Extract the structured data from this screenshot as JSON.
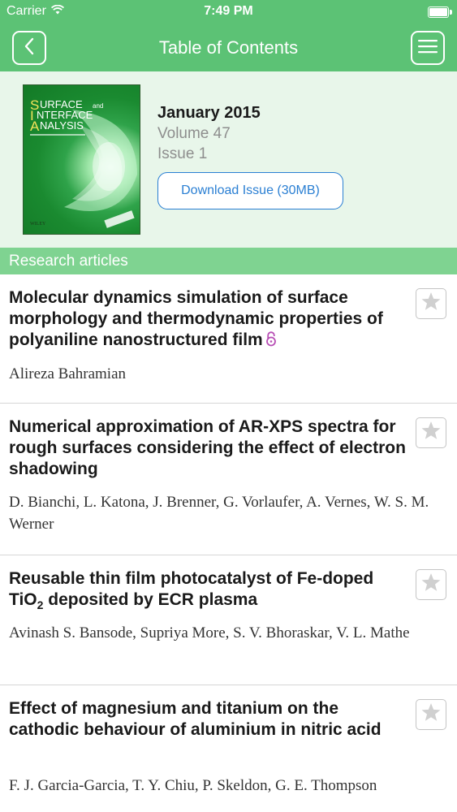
{
  "status_bar": {
    "carrier": "Carrier",
    "time": "7:49 PM"
  },
  "nav": {
    "title": "Table of Contents"
  },
  "issue": {
    "date": "January 2015",
    "volume": "Volume 47",
    "issue": "Issue 1",
    "download_label": "Download Issue (30MB)",
    "cover": {
      "line1": "URFACE",
      "line2": "NTERFACE",
      "line3": "NALYSIS",
      "initial1": "S",
      "initial2": "I",
      "initial3": "A",
      "and": "and",
      "publisher": "WILEY"
    }
  },
  "section": {
    "label": "Research articles"
  },
  "articles": [
    {
      "title": "Molecular dynamics simulation of surface morphology and thermodynamic properties of polyaniline nanostructured film",
      "authors": "Alireza Bahramian",
      "open_access": true
    },
    {
      "title": "Numerical approximation of AR-XPS spectra for rough surfaces considering the effect of electron shadowing",
      "authors": "D. Bianchi, L. Katona, J. Brenner, G. Vorlaufer, A. Vernes, W. S. M. Werner"
    },
    {
      "title_a": "Reusable thin film photocatalyst of Fe-doped TiO",
      "title_sub": "2",
      "title_b": " deposited by ECR plasma",
      "authors": "Avinash S. Bansode, Supriya More, S. V. Bhoraskar, V. L. Mathe"
    },
    {
      "title": "Effect of magnesium and titanium on the cathodic behaviour of aluminium in nitric acid",
      "authors": "F. J. Garcia-Garcia, T. Y. Chiu, P. Skeldon, G. E. Thompson"
    }
  ],
  "colors": {
    "brand_green": "#5cc275",
    "section_green": "#7fd391",
    "link_blue": "#2a7fd3",
    "open_access": "#b84fb5"
  },
  "icons": [
    "wifi-icon",
    "battery-icon",
    "back-chevron-icon",
    "menu-icon",
    "star-icon",
    "open-access-icon"
  ]
}
